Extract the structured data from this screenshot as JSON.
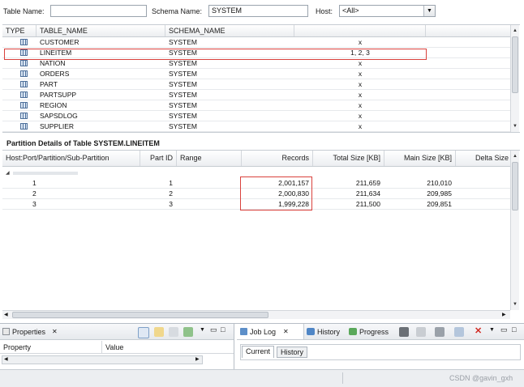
{
  "filters": {
    "table_name_label": "Table Name:",
    "table_name_value": "",
    "schema_name_label": "Schema Name:",
    "schema_name_value": "SYSTEM",
    "host_label": "Host:",
    "host_value": "<All>"
  },
  "tables_grid": {
    "headers": [
      "TYPE",
      "TABLE_NAME",
      "SCHEMA_NAME",
      ""
    ],
    "rows": [
      {
        "name": "CUSTOMER",
        "schema": "SYSTEM",
        "parts": "x"
      },
      {
        "name": "LINEITEM",
        "schema": "SYSTEM",
        "parts": "1, 2, 3"
      },
      {
        "name": "NATION",
        "schema": "SYSTEM",
        "parts": "x"
      },
      {
        "name": "ORDERS",
        "schema": "SYSTEM",
        "parts": "x"
      },
      {
        "name": "PART",
        "schema": "SYSTEM",
        "parts": "x"
      },
      {
        "name": "PARTSUPP",
        "schema": "SYSTEM",
        "parts": "x"
      },
      {
        "name": "REGION",
        "schema": "SYSTEM",
        "parts": "x"
      },
      {
        "name": "SAPSDLOG",
        "schema": "SYSTEM",
        "parts": "x"
      },
      {
        "name": "SUPPLIER",
        "schema": "SYSTEM",
        "parts": "x"
      }
    ]
  },
  "partition_details": {
    "title": "Partition Details of Table SYSTEM.LINEITEM",
    "headers": [
      "Host:Port/Partition/Sub-Partition",
      "Part ID",
      "Range",
      "Records",
      "Total Size [KB]",
      "Main Size [KB]",
      "Delta Size"
    ],
    "rows": [
      {
        "partition": "1",
        "part_id": "1",
        "range": "",
        "records": "2,001,157",
        "total": "211,659",
        "main": "210,010"
      },
      {
        "partition": "2",
        "part_id": "2",
        "range": "",
        "records": "2,000,830",
        "total": "211,634",
        "main": "209,985"
      },
      {
        "partition": "3",
        "part_id": "3",
        "range": "",
        "records": "1,999,228",
        "total": "211,500",
        "main": "209,851"
      }
    ]
  },
  "properties_view": {
    "tab_label": "Properties",
    "headers": [
      "Property",
      "Value"
    ]
  },
  "bottom_tabs": {
    "job_log": "Job Log",
    "history": "History",
    "progress": "Progress",
    "sub_tabs": [
      "Current",
      "History"
    ]
  },
  "watermark": "CSDN @gavin_gxh",
  "colors": {
    "highlight_box": "#d9413c",
    "tab_active": "#dfe8f4"
  }
}
